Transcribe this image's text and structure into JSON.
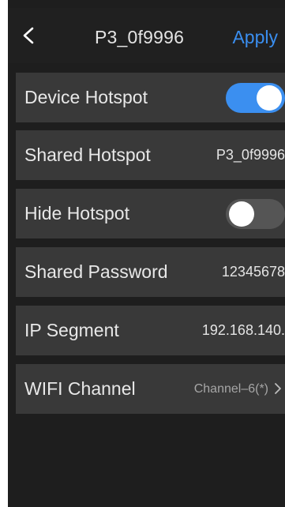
{
  "header": {
    "back_icon": "chevron-left-icon",
    "title": "P3_0f9996",
    "apply_label": "Apply"
  },
  "settings": [
    {
      "label": "Device Hotspot",
      "type": "toggle",
      "on": true
    },
    {
      "label": "Shared Hotspot",
      "type": "value",
      "value": "P3_0f9996"
    },
    {
      "label": "Hide Hotspot",
      "type": "toggle",
      "on": false
    },
    {
      "label": "Shared Password",
      "type": "value",
      "value": "12345678"
    },
    {
      "label": "IP Segment",
      "type": "value",
      "value": "192.168.140."
    },
    {
      "label": "WIFI Channel",
      "type": "select",
      "value": "Channel–6(*)",
      "chevron": ">"
    }
  ],
  "colors": {
    "background": "#1e1e1e",
    "row": "#393939",
    "accent": "#3a8eef",
    "toggle_on": "#3b8ff0",
    "toggle_off": "#555555"
  }
}
